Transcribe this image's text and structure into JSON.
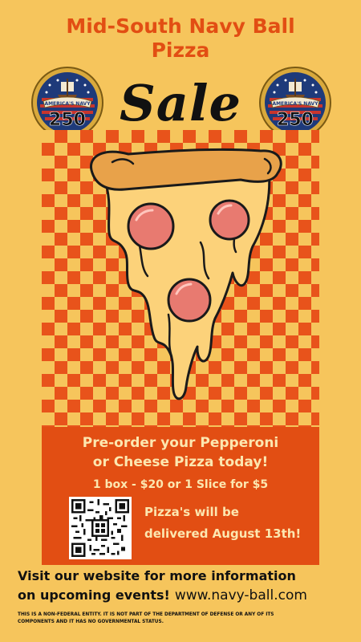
{
  "title": {
    "line1": "Mid-South Navy Ball",
    "line2": "Pizza",
    "sale": "Sale"
  },
  "seal": {
    "banner_text": "AMERICA'S NAVY",
    "number": "250"
  },
  "promo": {
    "line1": "Pre-order your Pepperoni",
    "line2": "or Cheese Pizza today!",
    "price": "1 box - $20 or 1 Slice for $5",
    "delivery_line1": "Pizza's will be",
    "delivery_line2": "delivered August 13th!"
  },
  "footer": {
    "visit_line1": "Visit our website for more information",
    "visit_line2": "on upcoming events!",
    "website": "www.navy-ball.com",
    "disclaimer_line1": "THIS IS A NON-FEDERAL ENTITY. IT IS NOT PART OF THE  DEPARTMENT OF DEFENSE OR ANY OF ITS",
    "disclaimer_line2": "COMPONENTS  AND IT HAS NO GOVERNMENTAL STATUS."
  },
  "colors": {
    "background": "#F6C55C",
    "accent_orange": "#E24E13",
    "text_cream": "#FCE7B0",
    "pepperoni": "#E87A70",
    "cheese": "#FCD27A"
  }
}
